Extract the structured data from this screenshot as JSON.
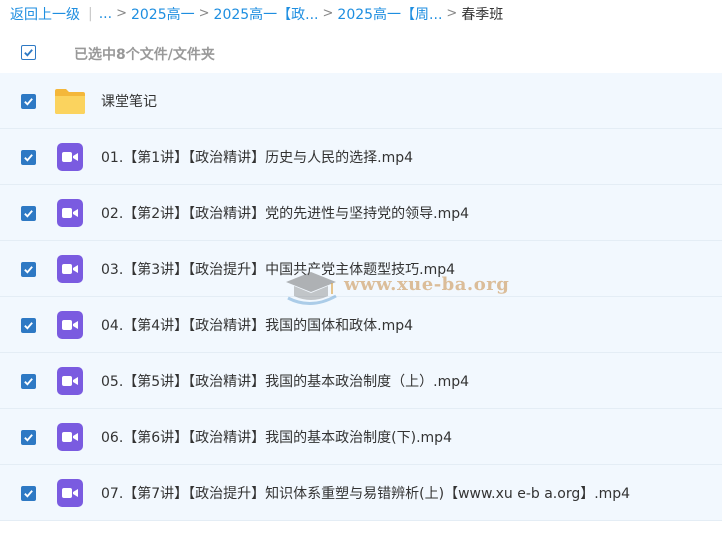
{
  "breadcrumb": {
    "back": "返回上一级",
    "ellipsis": "...",
    "crumbs": [
      "2025高一",
      "2025高一【政...",
      "2025高一【周..."
    ],
    "current": "春季班"
  },
  "selection": {
    "text": "已选中8个文件/文件夹"
  },
  "files": [
    {
      "name": "课堂笔记",
      "type": "folder"
    },
    {
      "name": "01.【第1讲】【政治精讲】历史与人民的选择.mp4",
      "type": "video"
    },
    {
      "name": "02.【第2讲】【政治精讲】党的先进性与坚持党的领导.mp4",
      "type": "video"
    },
    {
      "name": "03.【第3讲】【政治提升】中国共产党主体题型技巧.mp4",
      "type": "video"
    },
    {
      "name": "04.【第4讲】【政治精讲】我国的国体和政体.mp4",
      "type": "video"
    },
    {
      "name": "05.【第5讲】【政治精讲】我国的基本政治制度（上）.mp4",
      "type": "video"
    },
    {
      "name": "06.【第6讲】【政治精讲】我国的基本政治制度(下).mp4",
      "type": "video"
    },
    {
      "name": "07.【第7讲】【政治提升】知识体系重塑与易错辨析(上)【www.xu e-b a.org】.mp4",
      "type": "video"
    }
  ],
  "watermark": {
    "text": "www.xue-ba.org"
  },
  "colors": {
    "link": "#1e8ee0",
    "checkbox": "#2e79c4",
    "row_bg": "#f2f8fe",
    "video_icon": "#7a5be0",
    "folder": "#f7c84a"
  }
}
